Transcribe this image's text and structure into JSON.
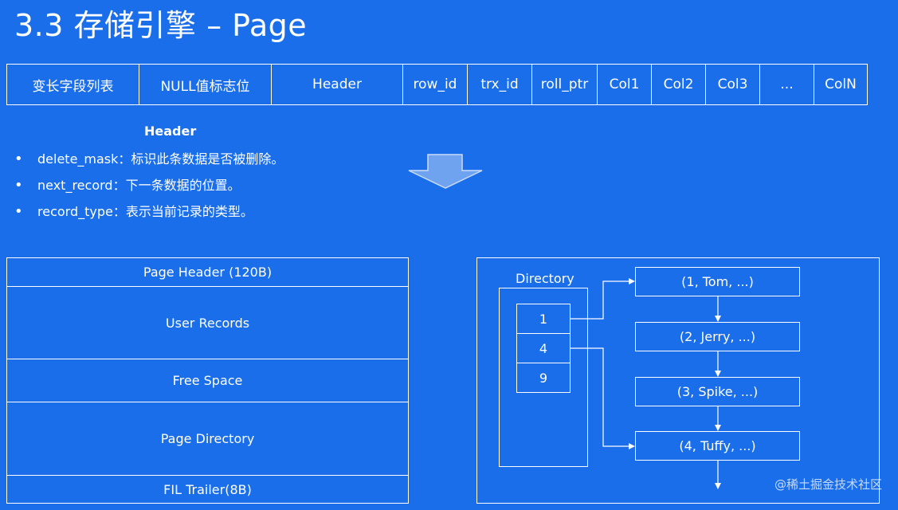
{
  "title": "3.3 存储引擎 –  Page",
  "row_format": {
    "cells": [
      "变长字段列表",
      "NULL值标志位",
      "Header",
      "row_id",
      "trx_id",
      "roll_ptr",
      "Col1",
      "Col2",
      "Col3",
      "...",
      "ColN"
    ]
  },
  "header_section": {
    "title": "Header",
    "bullets": [
      {
        "key": "delete_mask",
        "sep": "：",
        "desc": "标识此条数据是否被删除。"
      },
      {
        "key": "next_record",
        "sep": "：",
        "desc": "下一条数据的位置。"
      },
      {
        "key": "record_type",
        "sep": "：",
        "desc": "表示当前记录的类型。"
      }
    ]
  },
  "page_structure": {
    "blocks": [
      "Page Header (120B)",
      "User Records",
      "Free Space",
      "Page Directory",
      "FIL Trailer(8B)"
    ]
  },
  "directory": {
    "label": "Directory",
    "slots": [
      "1",
      "4",
      "9"
    ],
    "records": [
      "(1, Tom, ...)",
      "(2, Jerry, ...)",
      "(3, Spike, ...)",
      "(4, Tuffy, ...)"
    ]
  },
  "watermark": "@稀土掘金技术社区"
}
